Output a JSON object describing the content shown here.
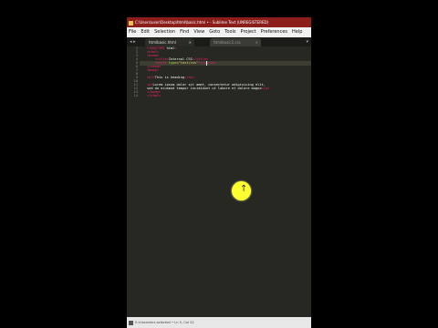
{
  "window": {
    "title": "C:\\Users\\user\\Desktop\\html\\basic.html • - Sublime Text (UNREGISTERED)"
  },
  "menu": [
    "File",
    "Edit",
    "Selection",
    "Find",
    "View",
    "Goto",
    "Tools",
    "Project",
    "Preferences",
    "Help"
  ],
  "tabs": [
    {
      "label": "htmlbasic.html",
      "active": true
    },
    {
      "label": "htmlbasic2.css",
      "active": false
    }
  ],
  "editor": {
    "line_numbers": [
      "1",
      "2",
      "3",
      "4",
      "5",
      "6",
      "7",
      "8",
      "9",
      "10",
      "11",
      "12",
      "13",
      "14"
    ],
    "lines": [
      "<!DOCTYPE html>",
      "<html>",
      "<head>",
      "    <title>Internal CSS</title>",
      "    <style type=\"text/css\"></style>",
      "</head>",
      "<body>",
      "",
      "<h1>This is heading</h1>",
      "",
      "<p>Lorem ipsum dolor sit amet, consectetur adipisicing elit,",
      "sed do eiusmod tempor incididunt ut labore et dolore magna</p>",
      "</body>",
      "</html>"
    ],
    "current_line": 5
  },
  "status": {
    "text": "0 characters selected • Ln 5, Col 22"
  },
  "colors": {
    "title_bar": "#8b1e1a",
    "editor_bg": "#272822",
    "tag": "#f92672",
    "attr": "#a6e22e",
    "string": "#e6db74",
    "pointer": "#ffff33"
  },
  "icons": {
    "pointer": "cursor-arrow-icon"
  }
}
